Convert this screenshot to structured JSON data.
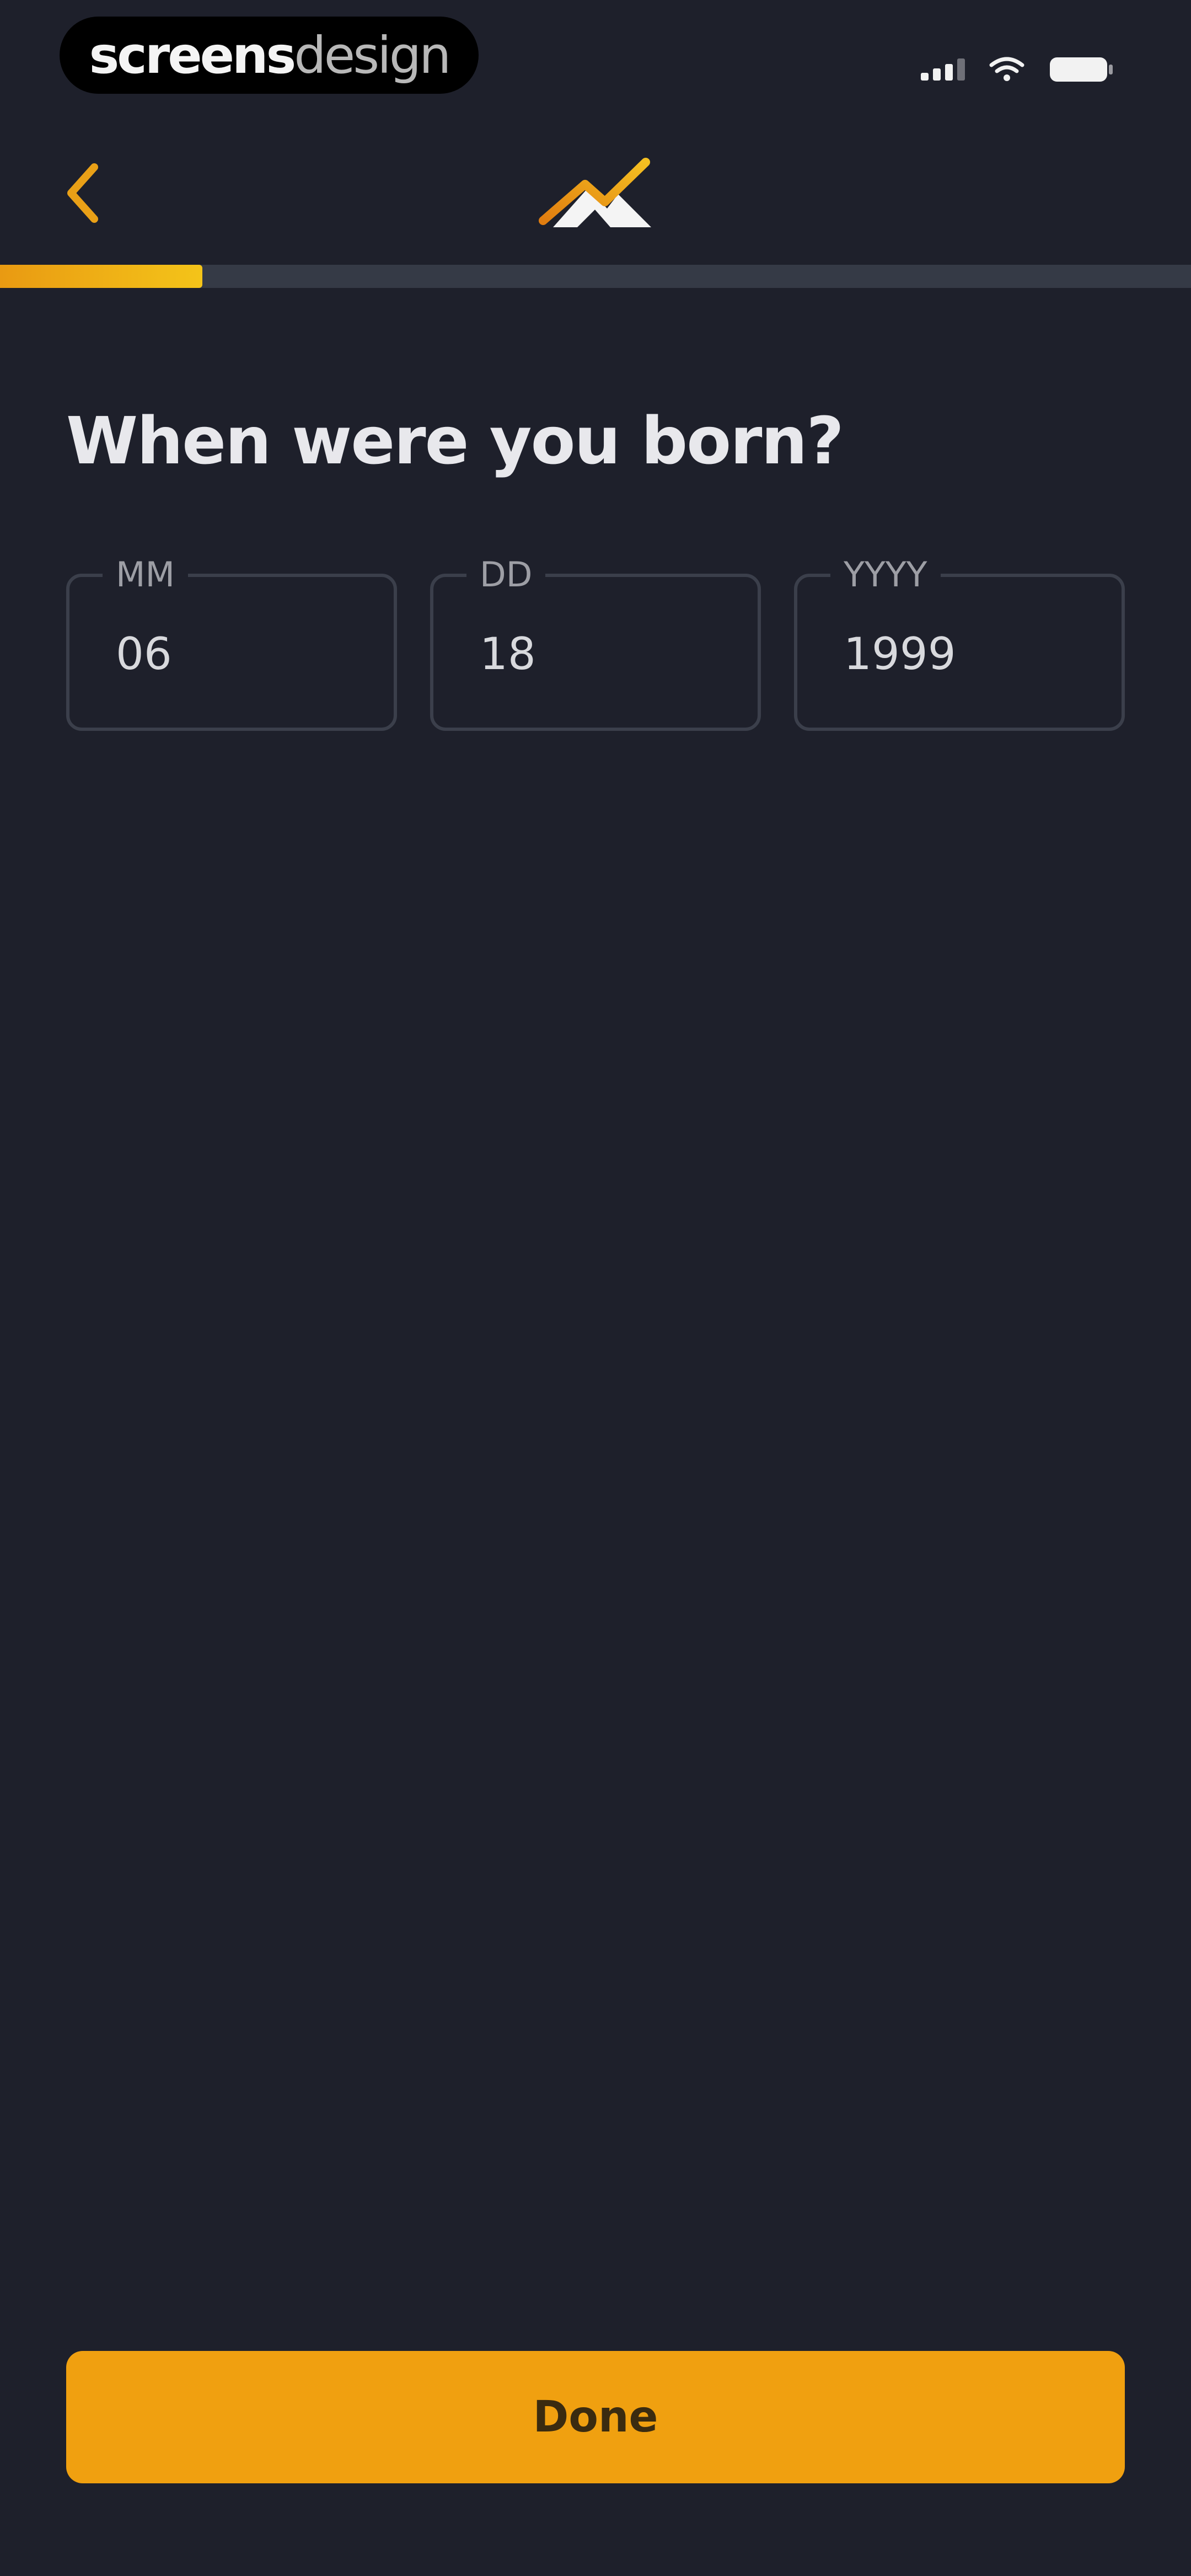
{
  "status_bar": {
    "brand_bold": "screens",
    "brand_light": "design",
    "icons": [
      "signal-icon",
      "wifi-icon",
      "battery-icon"
    ]
  },
  "nav": {
    "back_icon": "chevron-left-icon",
    "logo_icon": "mountain-logo-icon"
  },
  "progress": {
    "value": 0.17
  },
  "question": {
    "title": "When were you born?"
  },
  "date_fields": {
    "month": {
      "label": "MM",
      "value": "06"
    },
    "day": {
      "label": "DD",
      "value": "18"
    },
    "year": {
      "label": "YYYY",
      "value": "1999"
    }
  },
  "done_button": {
    "label": "Done"
  },
  "colors": {
    "background": "#1e202b",
    "accent": "#f0a010",
    "accent_light": "#f4c419",
    "field_border": "#3b3f4b",
    "progress_track": "#353a46"
  }
}
